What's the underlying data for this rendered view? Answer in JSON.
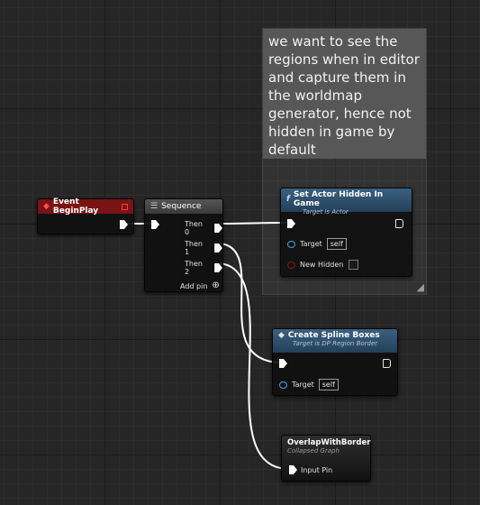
{
  "comment": {
    "text": "we want to see the regions when in editor and capture them in the worldmap generator, hence not hidden in game by default"
  },
  "nodes": {
    "begin_play": {
      "title": "Event BeginPlay",
      "color": "#7a1313"
    },
    "sequence": {
      "title": "Sequence",
      "color": "#404040",
      "outputs": [
        "Then 0",
        "Then 1",
        "Then 2"
      ],
      "add_pin": "Add pin"
    },
    "set_hidden": {
      "title": "Set Actor Hidden In Game",
      "subtitle": "Target is Actor",
      "color": "#2e4c6a",
      "target_label": "Target",
      "target_value": "self",
      "new_hidden_label": "New Hidden"
    },
    "spline_boxes": {
      "title": "Create Spline Boxes",
      "subtitle": "Target is DP Region Border",
      "color": "#2e4c6a",
      "target_label": "Target",
      "target_value": "self"
    },
    "overlap": {
      "title": "OverlapWithBorder",
      "subtitle": "Collapsed Graph",
      "input_label": "Input Pin"
    }
  }
}
